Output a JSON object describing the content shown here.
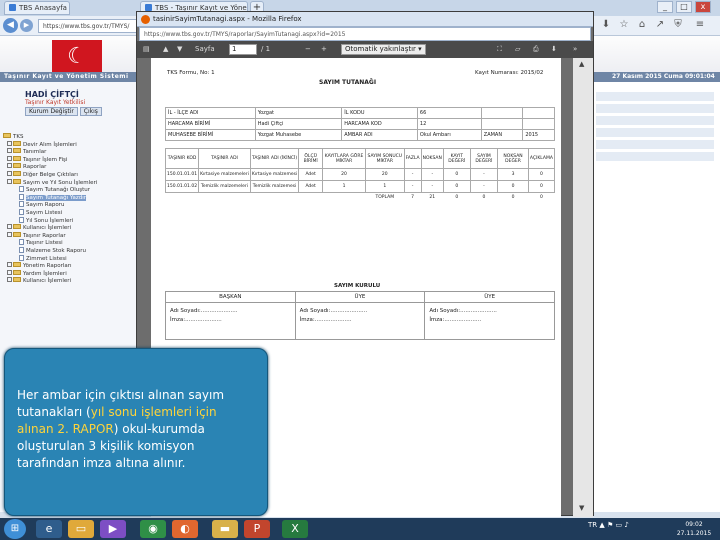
{
  "browser": {
    "tabs": [
      {
        "label": "TBS Anasayfa"
      },
      {
        "label": "TBS - Taşınır Kayıt ve Yöneti"
      }
    ],
    "bg_url": "https://www.tbs.gov.tr/TMYS/",
    "window_controls": [
      "_",
      "□",
      "x"
    ]
  },
  "site": {
    "band_title": "Taşınır Kayıt ve Yönetim Sistemi",
    "date_text": "27 Kasım 2015 Cuma 09:01:04"
  },
  "user": {
    "name": "HADİ ÇİFTÇİ",
    "subtitle": "Taşınır Kayıt Yetkilisi",
    "change_label": "Kurum Değiştir",
    "logout_label": "Çıkış"
  },
  "menu": [
    {
      "label": "TKS",
      "kind": "root"
    },
    {
      "label": "Devir Alım İşlemleri",
      "kind": "folder"
    },
    {
      "label": "Tanımlar",
      "kind": "folder"
    },
    {
      "label": "Taşınır İşlem Fişi",
      "kind": "folder"
    },
    {
      "label": "Raporlar",
      "kind": "folder"
    },
    {
      "label": "Diğer Belge Çıktıları",
      "kind": "folder"
    },
    {
      "label": "Sayım ve Yıl Sonu İşlemleri",
      "kind": "folder"
    },
    {
      "label": "Sayım Tutanağı Oluştur",
      "kind": "doc"
    },
    {
      "label": "Sayım Tutanağı Yazdır",
      "kind": "doc",
      "selected": true
    },
    {
      "label": "Sayım Raporu",
      "kind": "doc"
    },
    {
      "label": "Sayım Listesi",
      "kind": "doc"
    },
    {
      "label": "Yıl Sonu İşlemleri",
      "kind": "doc"
    },
    {
      "label": "Kullanıcı İşlemleri",
      "kind": "folder"
    },
    {
      "label": "Taşınır Raporlar",
      "kind": "folder"
    },
    {
      "label": "Taşınır Listesi",
      "kind": "doc"
    },
    {
      "label": "Malzeme Stok Raporu",
      "kind": "doc"
    },
    {
      "label": "Zimmet Listesi",
      "kind": "doc"
    },
    {
      "label": "Yönetim Raporları",
      "kind": "folder"
    },
    {
      "label": "Yardım İşlemleri",
      "kind": "folder"
    },
    {
      "label": "Kullanıcı İşlemleri",
      "kind": "folder"
    }
  ],
  "right_note": "ı",
  "popup": {
    "title": "tasinirSayimTutanagi.aspx - Mozilla Firefox",
    "url": "https://www.tbs.gov.tr/TMYS/raporlar/SayimTutanagi.aspx?id=2015",
    "toolbar": {
      "page_label": "Sayfa",
      "page_value": "1",
      "page_total": "/ 1",
      "zoom_label": "Otomatik yakınlaştır"
    }
  },
  "document": {
    "left_top": "TKS Formu, No: 1",
    "right_top": "Kayıt Numarası: 2015/02",
    "title": "SAYIM TUTANAĞI",
    "info": [
      [
        "İL - İLÇE ADI",
        "Yozgat",
        "İL KODU",
        "66",
        "",
        ""
      ],
      [
        "HARCAMA BİRİMİ",
        "Hadi Çiftçi",
        "HARCAMA KOD",
        "12",
        "",
        ""
      ],
      [
        "MUHASEBE BİRİMİ",
        "Yozgat Muhasebe",
        "AMBAR ADI",
        "Okul Ambarı",
        "ZAMAN",
        "2015"
      ]
    ],
    "grid_headers": [
      "TAŞINIR KOD",
      "TAŞINIR ADI",
      "TAŞINIR ADI (İKİNCİ)",
      "ÖLÇÜ BİRİMİ",
      "KAYITLARA GÖRE MİKTAR",
      "SAYIM SONUCU MİKTAR",
      "FAZLA",
      "NOKSAN",
      "KAYIT DEĞERİ",
      "SAYIM DEĞERİ",
      "NOKSAN DEĞER",
      "AÇIKLAMA"
    ],
    "grid_rows": [
      [
        "150.01.01.01",
        "Kırtasiye malzemeleri",
        "Kırtasiye malzemesi",
        "Adet",
        "20",
        "20",
        "-",
        "-",
        "0",
        "-",
        "3",
        "0"
      ],
      [
        "150.01.01.02",
        "Temizlik malzemeleri",
        "Temizlik malzemesi",
        "Adet",
        "1",
        "1",
        "-",
        "-",
        "0",
        "-",
        "0",
        "0"
      ]
    ],
    "grid_total": [
      "TOPLAM",
      "7",
      "21",
      "0",
      "0",
      "0",
      "0"
    ],
    "committee_title": "SAYIM KURULU",
    "signature_headers": [
      "BAŞKAN",
      "ÜYE",
      "ÜYE"
    ],
    "signature_name_label": "Adı Soyadı:",
    "signature_imza_label": "İmza:",
    "signature_dots": "....................."
  },
  "callout": {
    "part1": "Her ambar için çıktısı alınan sayım tutanakları (",
    "highlight": "yıl sonu işlemleri için alınan 2. RAPOR",
    "part2": ") okul-kurumda oluşturulan 3 kişilik komisyon tarafından imza altına alınır."
  },
  "taskbar": {
    "time": "09:02",
    "date": "27.11.2015",
    "tray_lang": "TR"
  }
}
